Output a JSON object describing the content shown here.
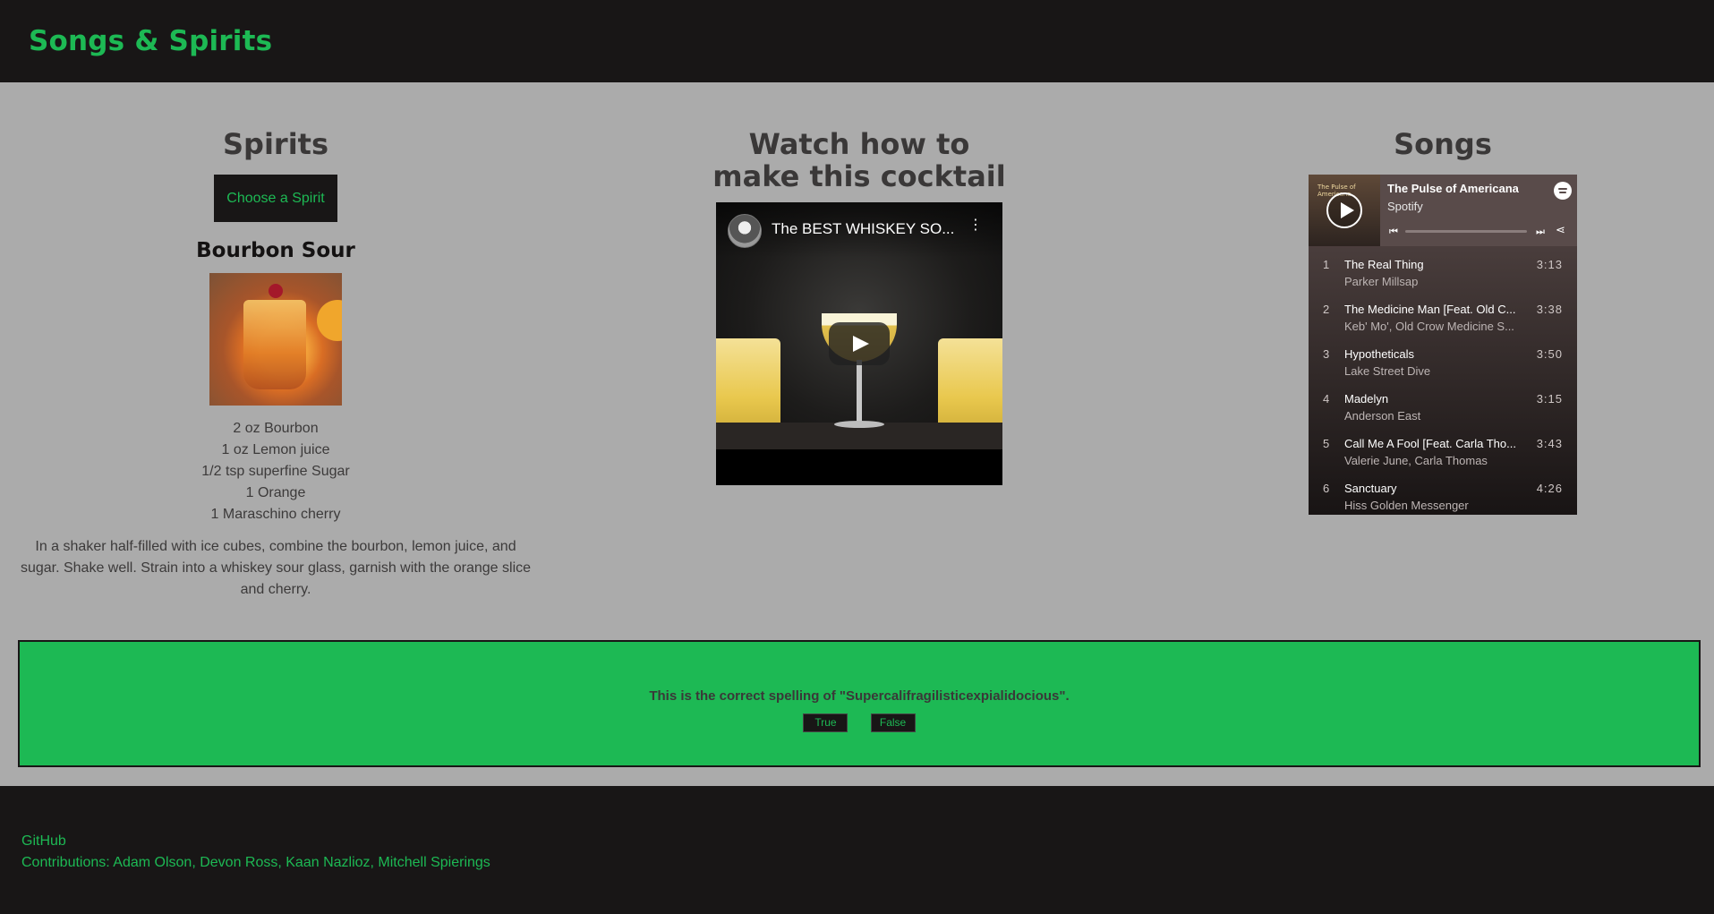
{
  "header": {
    "brand": "Songs & Spirits"
  },
  "spirits": {
    "title": "Spirits",
    "choose_label": "Choose a Spirit",
    "recipe_name": "Bourbon Sour",
    "ingredients": [
      "2 oz Bourbon",
      "1 oz Lemon juice",
      "1/2 tsp superfine Sugar",
      "1 Orange",
      "1 Maraschino cherry"
    ],
    "instructions": "In a shaker half-filled with ice cubes, combine the bourbon, lemon juice, and sugar. Shake well. Strain into a whiskey sour glass, garnish with the orange slice and cherry."
  },
  "video": {
    "title": "Watch how to make this cocktail",
    "video_title": "The BEST WHISKEY SO..."
  },
  "songs": {
    "title": "Songs",
    "playlist_title": "The Pulse of Americana",
    "playlist_sub": "Spotify",
    "cover_text": "The Pulse of Americana",
    "tracks": [
      {
        "num": "1",
        "name": "The Real Thing",
        "artist": "Parker Millsap",
        "duration": "3:13"
      },
      {
        "num": "2",
        "name": "The Medicine Man [Feat. Old C...",
        "artist": "Keb' Mo', Old Crow Medicine S...",
        "duration": "3:38"
      },
      {
        "num": "3",
        "name": "Hypotheticals",
        "artist": "Lake Street Dive",
        "duration": "3:50"
      },
      {
        "num": "4",
        "name": "Madelyn",
        "artist": "Anderson East",
        "duration": "3:15"
      },
      {
        "num": "5",
        "name": "Call Me A Fool [Feat. Carla Tho...",
        "artist": "Valerie June, Carla Thomas",
        "duration": "3:43"
      },
      {
        "num": "6",
        "name": "Sanctuary",
        "artist": "Hiss Golden Messenger",
        "duration": "4:26"
      }
    ]
  },
  "quiz": {
    "question": "This is the correct spelling of \"Supercalifragilisticexpialidocious\".",
    "true_label": "True",
    "false_label": "False"
  },
  "footer": {
    "github": "GitHub",
    "contributions": "Contributions: Adam Olson, Devon Ross, Kaan Nazlioz, Mitchell Spierings"
  },
  "colors": {
    "accent": "#1db954",
    "dark": "#181616",
    "panel": "#ababab"
  }
}
